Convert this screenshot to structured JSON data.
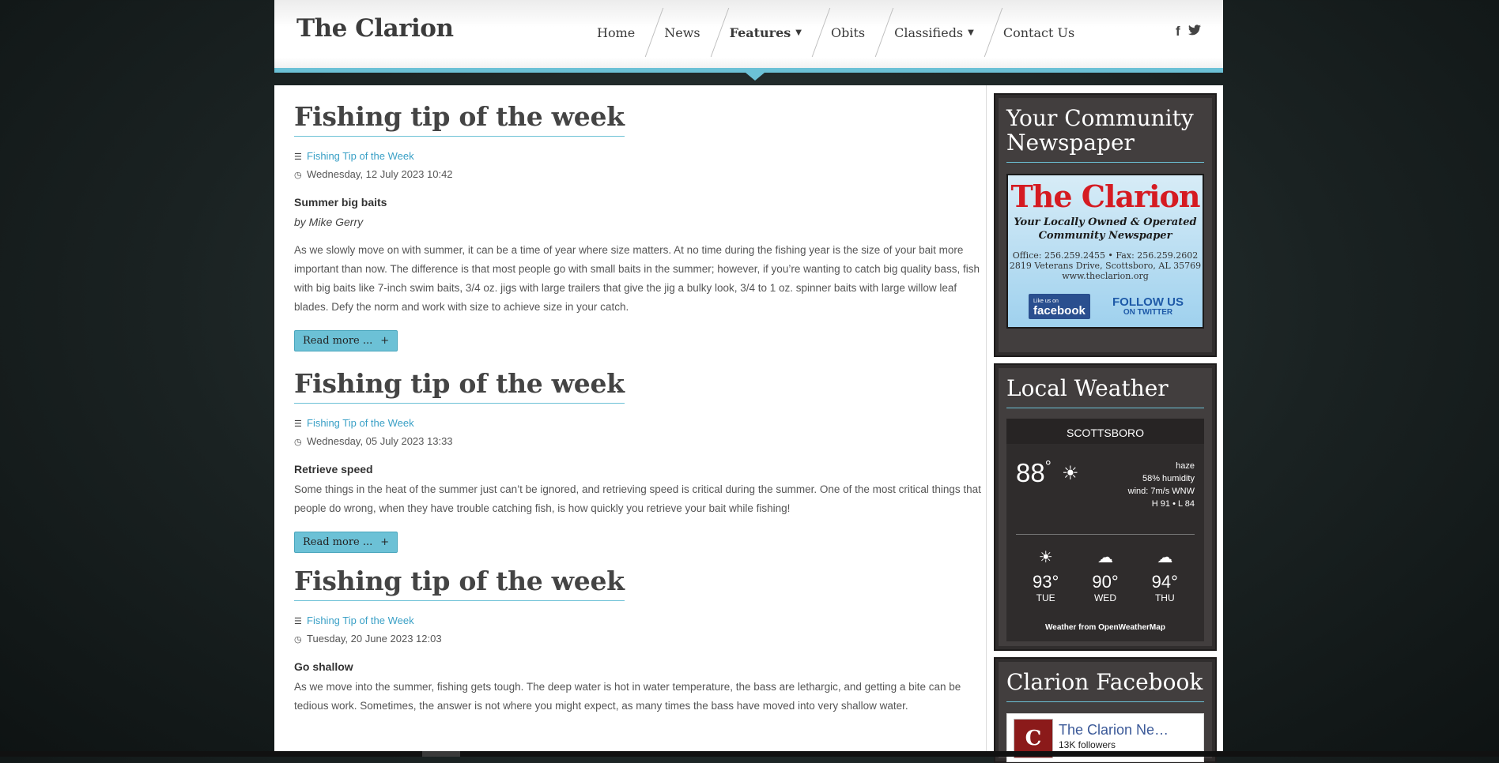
{
  "site": {
    "name": "The Clarion"
  },
  "nav": {
    "items": [
      {
        "label": "Home"
      },
      {
        "label": "News"
      },
      {
        "label": "Features"
      },
      {
        "label": "Obits"
      },
      {
        "label": "Classifieds"
      },
      {
        "label": "Contact Us"
      }
    ],
    "social": {
      "facebook": "f",
      "twitter": "🐦"
    }
  },
  "articles": [
    {
      "title": "Fishing tip of the week",
      "category": "Fishing Tip of the Week",
      "date": "Wednesday, 12 July 2023 10:42",
      "subtitle": "Summer big baits",
      "author": "by Mike Gerry",
      "body": "As we slowly move on with summer, it can be a time of year where size matters. At no time during the fishing year is the size of your bait more important than now. The difference is that most people go with small baits in the summer; however, if you’re wanting to catch big quality bass, fish with big baits like 7-inch swim baits, 3/4 oz. jigs with large trailers that give the jig a bulky look, 3/4 to 1 oz. spinner baits with large willow leaf blades. Defy the norm and work with size to achieve size in your catch.",
      "read_more": "Read more ...",
      "plus": "+"
    },
    {
      "title": "Fishing tip of the week",
      "category": "Fishing Tip of the Week",
      "date": "Wednesday, 05 July 2023 13:33",
      "subtitle": "Retrieve speed",
      "body": "Some things in the heat of the summer just can’t be ignored, and retrieving speed is critical during the summer. One of the most critical things that people do wrong, when they have trouble catching fish, is how quickly you retrieve your bait while fishing!",
      "read_more": "Read more ...",
      "plus": "+"
    },
    {
      "title": "Fishing tip of the week",
      "category": "Fishing Tip of the Week",
      "date": "Tuesday, 20 June 2023 12:03",
      "subtitle": "Go shallow",
      "body": "As we move into the summer, fishing gets tough. The deep water is hot in water temperature, the bass are lethargic, and getting a bite can be tedious work. Sometimes, the answer is not where you might expect, as many times the bass have moved into very shallow water."
    }
  ],
  "sidebar": {
    "community": {
      "title": "Your Community Newspaper",
      "ad": {
        "title": "The Clarion",
        "tagline1": "Your Locally Owned & Operated",
        "tagline2": "Community Newspaper",
        "phone": "Office: 256.259.2455 • Fax: 256.259.2602",
        "address": "2819 Veterans Drive, Scottsboro, AL 35769",
        "web": "www.theclarion.org",
        "fb_small": "Like us on",
        "fb_label": "facebook",
        "tw_label": "FOLLOW US",
        "tw_small": "ON TWITTER"
      }
    },
    "weather": {
      "title": "Local Weather",
      "city": "SCOTTSBORO",
      "temp": "88",
      "deg": "°",
      "condition": "haze",
      "humidity": "58% humidity",
      "wind": "wind: 7m/s WNW",
      "hilo": "H 91 • L 84",
      "forecast": [
        {
          "icon": "☀",
          "temp": "93°",
          "day": "TUE"
        },
        {
          "icon": "☁",
          "temp": "90°",
          "day": "WED"
        },
        {
          "icon": "☁",
          "temp": "94°",
          "day": "THU"
        }
      ],
      "credit": "Weather from OpenWeatherMap"
    },
    "facebook": {
      "title": "Clarion Facebook",
      "page_name": "The Clarion Ne…",
      "followers": "13K followers",
      "avatar_letter": "C"
    }
  }
}
